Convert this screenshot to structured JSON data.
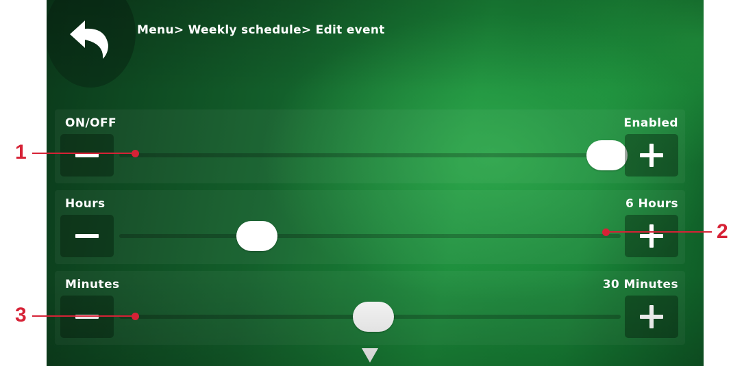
{
  "header": {
    "breadcrumb": "Menu> Weekly schedule> Edit event",
    "back_icon": "back-arrow-icon"
  },
  "rows": [
    {
      "label": "ON/OFF",
      "value": "Enabled",
      "level": 1.0,
      "minus_icon": "minus-icon",
      "plus_icon": "plus-icon"
    },
    {
      "label": "Hours",
      "value": "6 Hours",
      "level": 0.25,
      "minus_icon": "minus-icon",
      "plus_icon": "plus-icon"
    },
    {
      "label": "Minutes",
      "value": "30 Minutes",
      "level": 0.5,
      "minus_icon": "minus-icon",
      "plus_icon": "plus-icon"
    }
  ],
  "scroll_icon": "triangle-down-icon",
  "callouts": [
    "1",
    "2",
    "3"
  ],
  "colors": {
    "background_dark": "#0b3a1b",
    "background_bright": "#1b8a3a",
    "text": "#ffffff",
    "callout": "#d62236"
  }
}
